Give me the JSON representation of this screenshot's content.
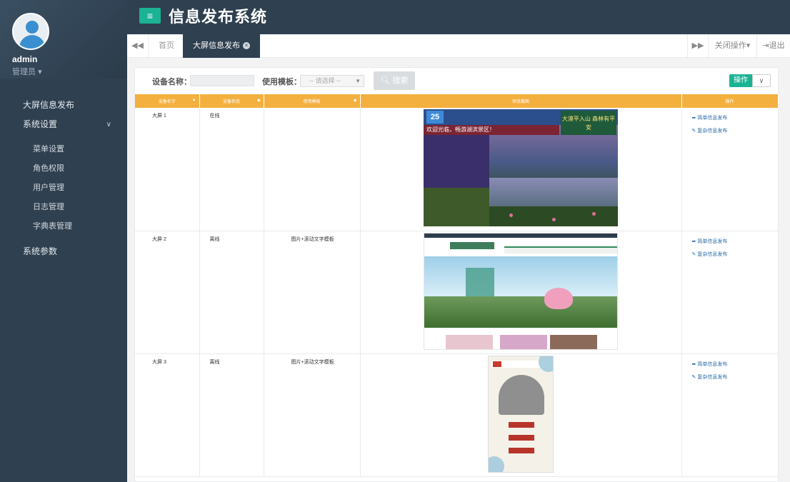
{
  "header": {
    "title": "信息发布系统",
    "menu_icon": "hamburger-icon"
  },
  "user": {
    "name": "admin",
    "role": "管理员"
  },
  "sidebar": {
    "items": [
      {
        "label": "大屏信息发布"
      },
      {
        "label": "系统设置"
      },
      {
        "label": "菜单设置"
      },
      {
        "label": "角色权限"
      },
      {
        "label": "用户管理"
      },
      {
        "label": "日志管理"
      },
      {
        "label": "字典表管理"
      },
      {
        "label": "系统参数"
      }
    ]
  },
  "tabs": {
    "home": "首页",
    "active": "大屏信息发布",
    "close_ops": "关闭操作",
    "logout": "退出"
  },
  "search": {
    "device_label": "设备名称：",
    "template_label": "使用模板：",
    "template_placeholder": "-- 请选择 --",
    "button": "搜索",
    "ops_button": "操作"
  },
  "table": {
    "columns": [
      "设备名字",
      "设备状态",
      "使用模板",
      "预览截图",
      "操作"
    ],
    "rows": [
      {
        "name": "大屏 1",
        "status": "在线",
        "template": "",
        "action1": "简单信息发布",
        "action2": "复杂信息发布"
      },
      {
        "name": "大屏 2",
        "status": "离线",
        "template": "图片+滚动文字模板",
        "action1": "简单信息发布",
        "action2": "复杂信息发布"
      },
      {
        "name": "大屏 3",
        "status": "离线",
        "template": "图片+滚动文字模板",
        "action1": "简单信息发布",
        "action2": "复杂信息发布"
      }
    ]
  },
  "preview1": {
    "day": "25",
    "banner": "欢迎光临，畅游湖滨景区！",
    "slogan": "大漠平入山 森林有平安"
  },
  "colors": {
    "sidebar": "#2f4050",
    "accent": "#1ab394",
    "table_header": "#f4b03e",
    "link": "#2a6aa7"
  }
}
